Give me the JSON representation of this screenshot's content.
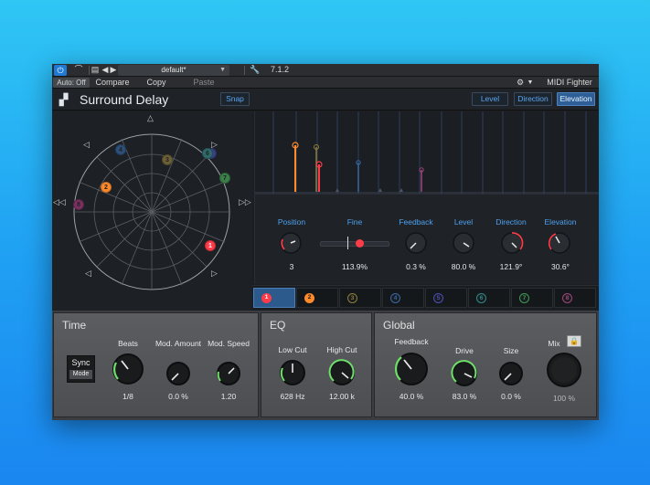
{
  "host": {
    "power_icon": "power-icon",
    "preset_name": "default*",
    "version": "7.1.2",
    "auto": "Auto: Off",
    "compare": "Compare",
    "copy": "Copy",
    "paste": "Paste",
    "midi_fighter": "MIDI Fighter"
  },
  "plugin": {
    "title": "Surround Delay",
    "snap": "Snap",
    "view_buttons": [
      "Level",
      "Direction",
      "Elevation"
    ],
    "active_view": "Elevation"
  },
  "panner": {
    "dots": [
      {
        "n": "1",
        "color": "#ff3b47"
      },
      {
        "n": "2",
        "color": "#ff8a2a"
      },
      {
        "n": "3",
        "color": "#6b6036"
      },
      {
        "n": "4",
        "color": "#2d4f7a"
      },
      {
        "n": "5",
        "color": "#3a3f86"
      },
      {
        "n": "6",
        "color": "#2f6b6a"
      },
      {
        "n": "7",
        "color": "#3b7f4a"
      },
      {
        "n": "8",
        "color": "#7a3060"
      }
    ]
  },
  "params": {
    "labels": [
      "Position",
      "Fine",
      "Feedback",
      "Level",
      "Direction",
      "Elevation"
    ],
    "values": [
      "3",
      "113.9%",
      "0.3 %",
      "80.0 %",
      "121.9°",
      "30.6°"
    ]
  },
  "taps": [
    "1",
    "2",
    "3",
    "4",
    "5",
    "6",
    "7",
    "8"
  ],
  "tap_colors": [
    "#ff3b47",
    "#ff8a2a",
    "#8d7d3a",
    "#3768a6",
    "#4a4fb0",
    "#2f8a88",
    "#3f9a55",
    "#a0457e"
  ],
  "time": {
    "title": "Time",
    "sync": "Sync",
    "mode": "Mode",
    "knobs": [
      {
        "label": "Beats",
        "value": "1/8"
      },
      {
        "label": "Mod. Amount",
        "value": "0.0 %"
      },
      {
        "label": "Mod. Speed",
        "value": "1.20"
      }
    ]
  },
  "eq": {
    "title": "EQ",
    "knobs": [
      {
        "label": "Low Cut",
        "value": "628 Hz"
      },
      {
        "label": "High Cut",
        "value": "12.00 k"
      }
    ]
  },
  "global": {
    "title": "Global",
    "knobs": [
      {
        "label": "Feedback",
        "value": "40.0 %"
      },
      {
        "label": "Drive",
        "value": "83.0 %"
      },
      {
        "label": "Size",
        "value": "0.0 %"
      },
      {
        "label": "Mix",
        "value": "100 %"
      }
    ]
  }
}
